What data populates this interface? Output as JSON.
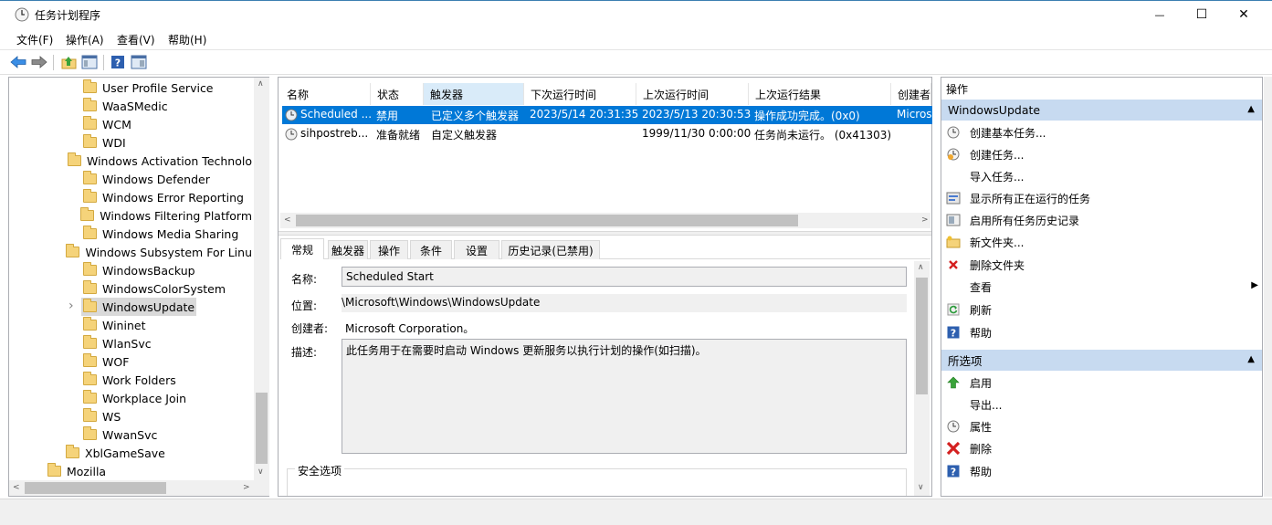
{
  "window": {
    "title": "任务计划程序",
    "minimize_glyph": "—",
    "maximize_glyph": "☐",
    "close_glyph": "✕"
  },
  "menu": [
    "文件(F)",
    "操作(A)",
    "查看(V)",
    "帮助(H)"
  ],
  "tree": {
    "items": [
      {
        "label": "User Profile Service",
        "level": 2
      },
      {
        "label": "WaaSMedic",
        "level": 2
      },
      {
        "label": "WCM",
        "level": 2
      },
      {
        "label": "WDI",
        "level": 2
      },
      {
        "label": "Windows Activation Technolo",
        "level": 2
      },
      {
        "label": "Windows Defender",
        "level": 2
      },
      {
        "label": "Windows Error Reporting",
        "level": 2
      },
      {
        "label": "Windows Filtering Platform",
        "level": 2
      },
      {
        "label": "Windows Media Sharing",
        "level": 2
      },
      {
        "label": "Windows Subsystem For Linu",
        "level": 2
      },
      {
        "label": "WindowsBackup",
        "level": 2
      },
      {
        "label": "WindowsColorSystem",
        "level": 2
      },
      {
        "label": "WindowsUpdate",
        "level": 2,
        "selected": true,
        "expandable": true
      },
      {
        "label": "Wininet",
        "level": 2
      },
      {
        "label": "WlanSvc",
        "level": 2
      },
      {
        "label": "WOF",
        "level": 2
      },
      {
        "label": "Work Folders",
        "level": 2
      },
      {
        "label": "Workplace Join",
        "level": 2
      },
      {
        "label": "WS",
        "level": 2
      },
      {
        "label": "WwanSvc",
        "level": 2
      },
      {
        "label": "XblGameSave",
        "level": 1
      },
      {
        "label": "Mozilla",
        "level": 0
      }
    ]
  },
  "task_list": {
    "columns": [
      "名称",
      "状态",
      "触发器",
      "下次运行时间",
      "上次运行时间",
      "上次运行结果",
      "创建者"
    ],
    "rows": [
      {
        "name": "Scheduled ...",
        "status": "禁用",
        "trigger": "已定义多个触发器",
        "next_run": "2023/5/14 20:31:35",
        "last_run": "2023/5/13 20:30:53",
        "result": "操作成功完成。(0x0)",
        "author": "Micros",
        "selected": true
      },
      {
        "name": "sihpostreb...",
        "status": "准备就绪",
        "trigger": "自定义触发器",
        "next_run": "",
        "last_run": "1999/11/30 0:00:00",
        "result": "任务尚未运行。 (0x41303)",
        "author": "",
        "selected": false
      }
    ]
  },
  "detail_tabs": [
    "常规",
    "触发器",
    "操作",
    "条件",
    "设置",
    "历史记录(已禁用)"
  ],
  "general": {
    "name_label": "名称:",
    "name_value": "Scheduled Start",
    "location_label": "位置:",
    "location_value": "\\Microsoft\\Windows\\WindowsUpdate",
    "author_label": "创建者:",
    "author_value": "Microsoft Corporation。",
    "desc_label": "描述:",
    "desc_value": "此任务用于在需要时启动 Windows 更新服务以执行计划的操作(如扫描)。",
    "security_label": "安全选项"
  },
  "actions_pane": {
    "header": "操作",
    "section1": "WindowsUpdate",
    "section1_items": [
      {
        "label": "创建基本任务...",
        "icon": "clock-wizard-icon"
      },
      {
        "label": "创建任务...",
        "icon": "clock-task-icon"
      },
      {
        "label": "导入任务...",
        "icon": ""
      },
      {
        "label": "显示所有正在运行的任务",
        "icon": "running-tasks-icon"
      },
      {
        "label": "启用所有任务历史记录",
        "icon": "history-icon"
      },
      {
        "label": "新文件夹...",
        "icon": "new-folder-icon"
      },
      {
        "label": "删除文件夹",
        "icon": "delete-x-icon"
      },
      {
        "label": "查看",
        "icon": "",
        "submenu": true
      },
      {
        "label": "刷新",
        "icon": "refresh-icon"
      },
      {
        "label": "帮助",
        "icon": "help-icon"
      }
    ],
    "section2": "所选项",
    "section2_items": [
      {
        "label": "启用",
        "icon": "enable-arrow-icon"
      },
      {
        "label": "导出...",
        "icon": ""
      },
      {
        "label": "属性",
        "icon": "clock-properties-icon"
      },
      {
        "label": "删除",
        "icon": "delete-red-x-icon"
      },
      {
        "label": "帮助",
        "icon": "help-icon"
      }
    ]
  },
  "colors": {
    "selection": "#0078d7",
    "section_header": "#c7daf0",
    "help_blue": "#2d5faf",
    "delete_red": "#d42020"
  }
}
